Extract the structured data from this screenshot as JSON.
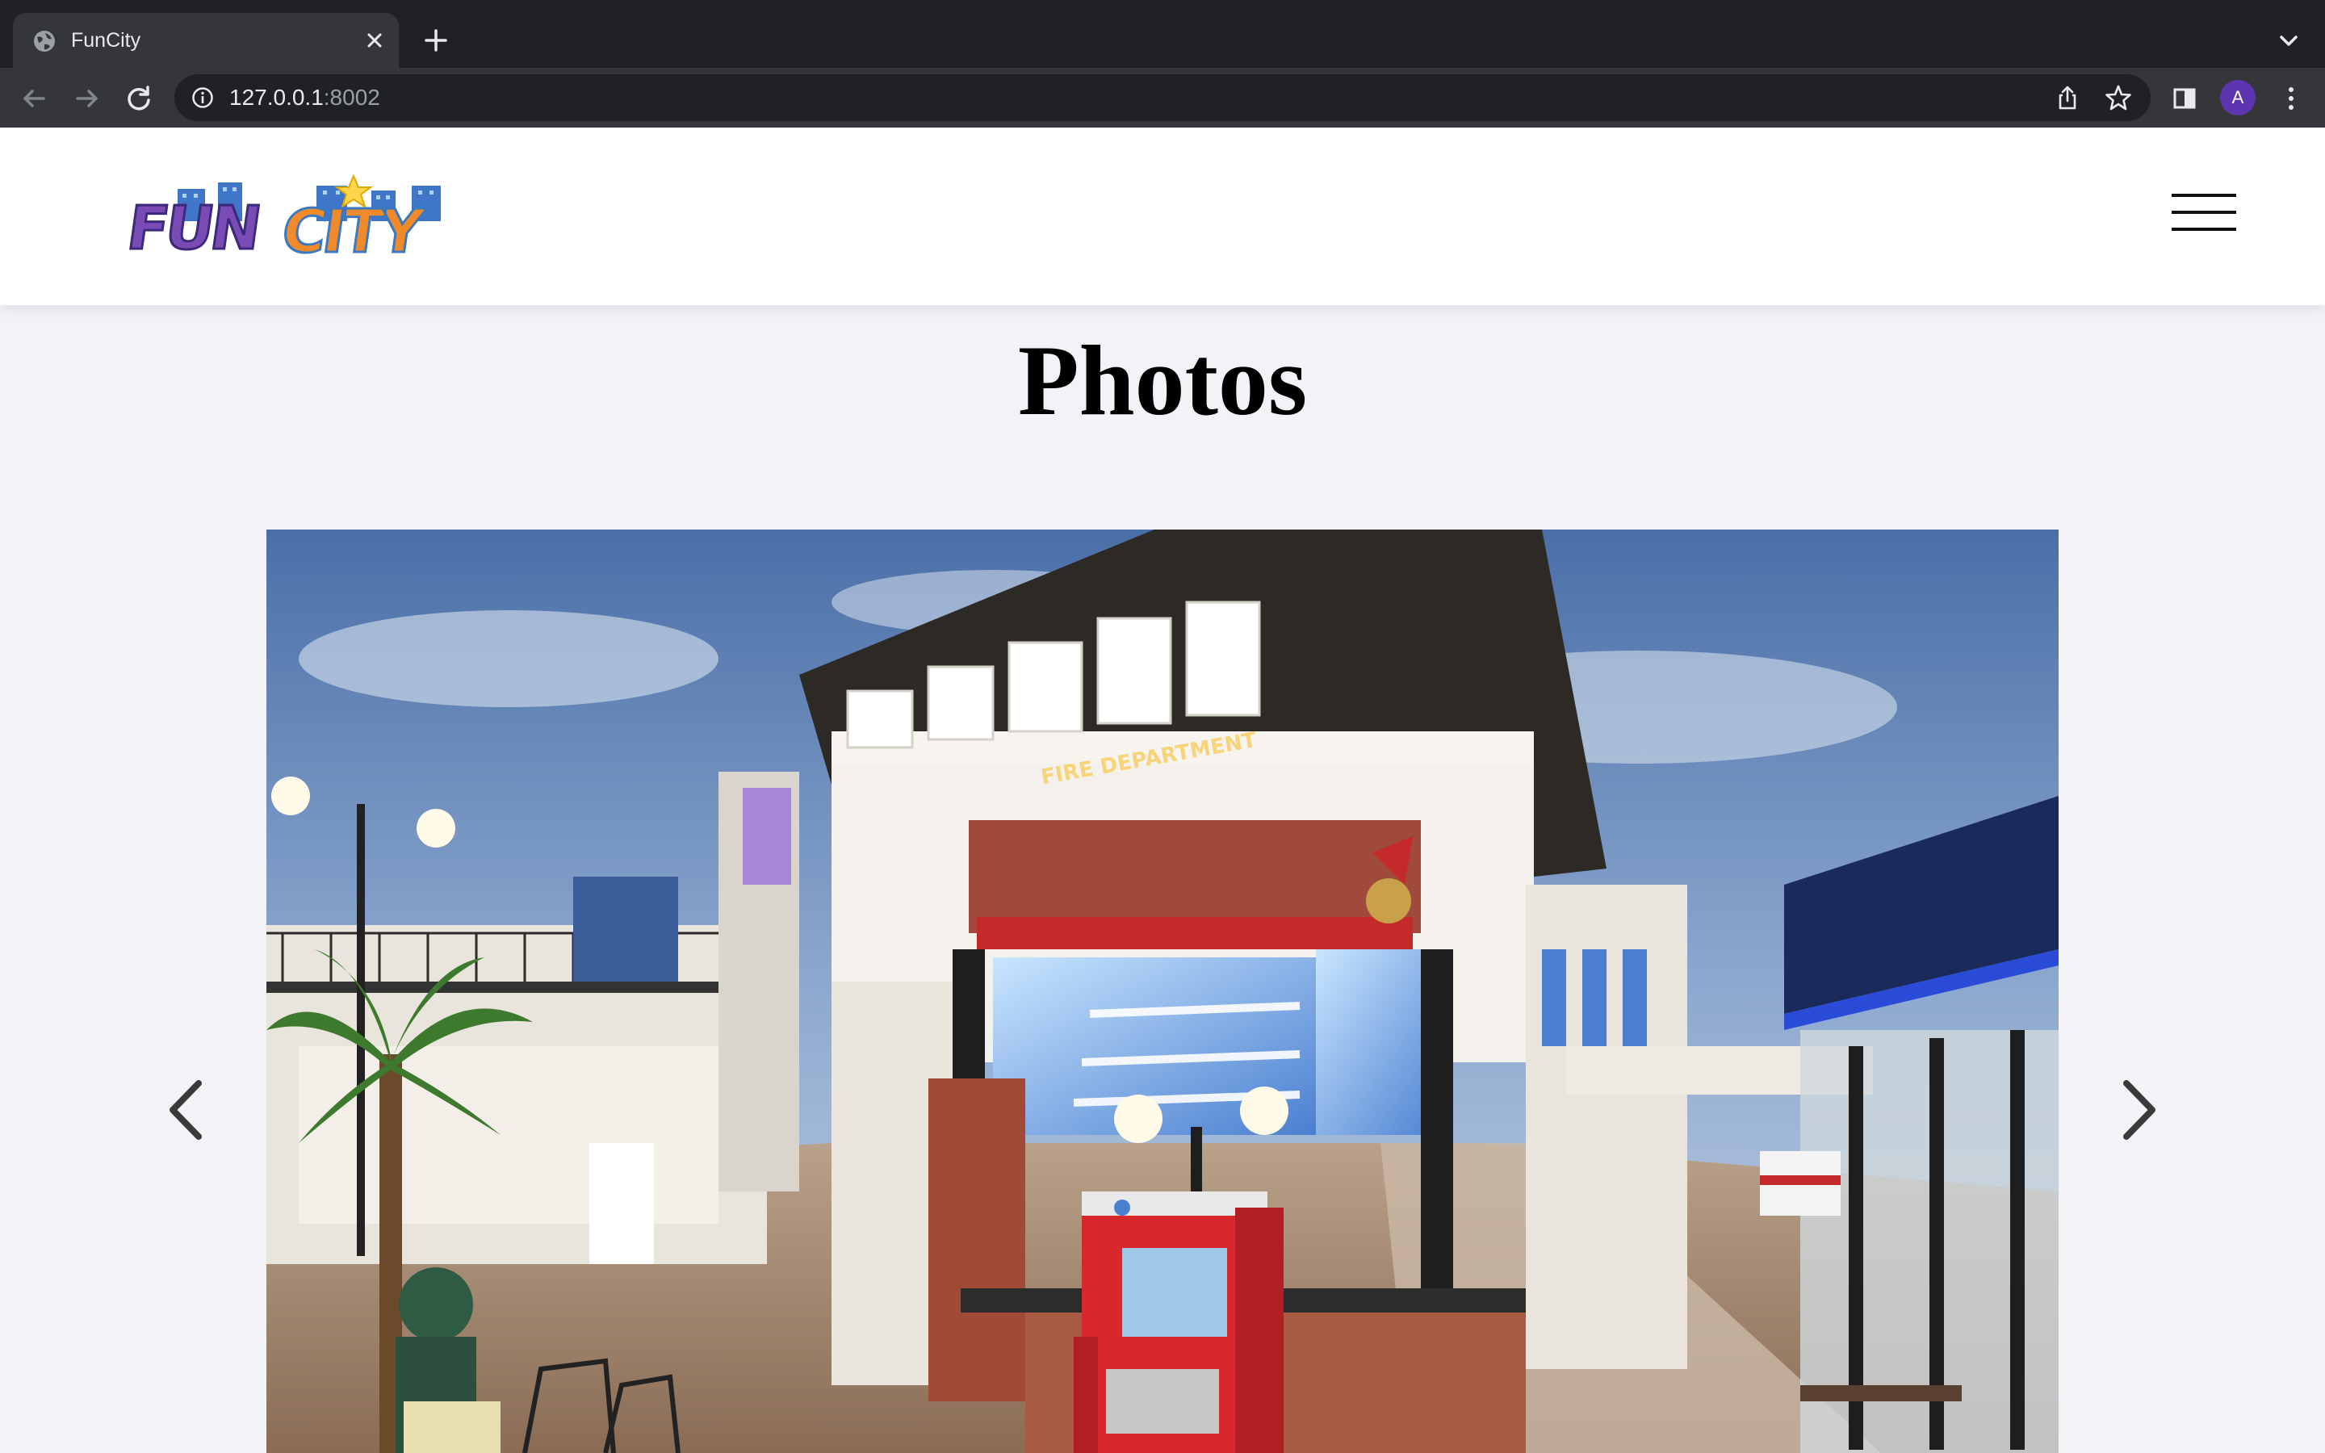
{
  "browser": {
    "tab_title": "FunCity",
    "url_host": "127.0.0.1",
    "url_port": ":8002",
    "profile_initial": "A"
  },
  "site": {
    "logo_alt": "FunCity",
    "logo_text": "FUN CITY"
  },
  "page": {
    "title": "Photos"
  },
  "carousel": {
    "photo_alt": "Fire department building with red fire truck in indoor city",
    "photo_sign": "FIRE DEPARTMENT",
    "prev_label": "Previous",
    "next_label": "Next"
  },
  "colors": {
    "chrome_dark": "#202124",
    "chrome_mid": "#35363a",
    "page_bg": "#f3f3f7",
    "logo_purple": "#6a3fa0",
    "logo_orange": "#f08a2a",
    "logo_blue": "#3aa0dc",
    "truck_red": "#d8282c"
  }
}
